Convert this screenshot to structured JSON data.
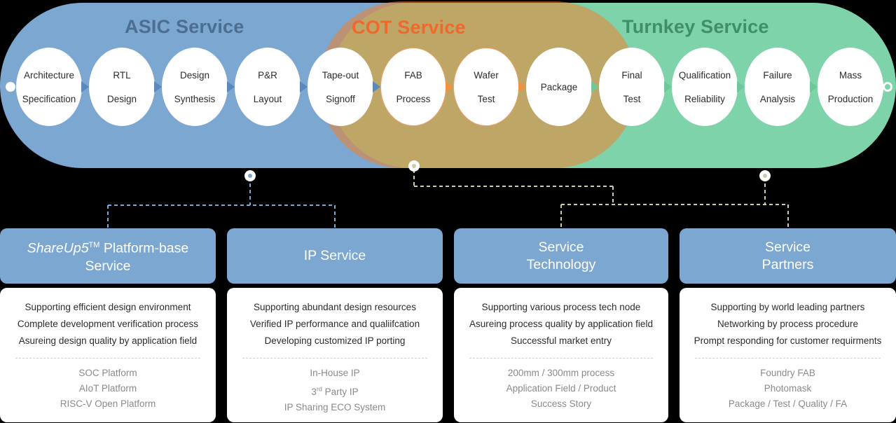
{
  "bands": [
    {
      "id": "asic",
      "title": "ASIC Service",
      "color": "#4b6e92"
    },
    {
      "id": "cot",
      "title": "COT Service",
      "color": "#f1682a"
    },
    {
      "id": "turnkey",
      "title": "Turnkey Service",
      "color": "#3f8f68"
    }
  ],
  "flow": {
    "nodes": [
      {
        "line1": "Architecture",
        "line2": "Specification"
      },
      {
        "line1": "RTL",
        "line2": "Design"
      },
      {
        "line1": "Design",
        "line2": "Synthesis"
      },
      {
        "line1": "P&R",
        "line2": "Layout"
      },
      {
        "line1": "Tape-out",
        "line2": "Signoff"
      },
      {
        "line1": "FAB",
        "line2": "Process"
      },
      {
        "line1": "Wafer",
        "line2": "Test"
      },
      {
        "line1": "Package",
        "line2": ""
      },
      {
        "line1": "Final",
        "line2": "Test"
      },
      {
        "line1": "Qualification",
        "line2": "Reliability"
      },
      {
        "line1": "Failure",
        "line2": "Analysis"
      },
      {
        "line1": "Mass",
        "line2": "Production"
      }
    ]
  },
  "cards": [
    {
      "title_pre": "ShareUp5",
      "title_tm": "TM",
      "title_post": " Platform-base Service",
      "primary": [
        "Supporting efficient design environment",
        "Complete development verification process",
        "Asureing design quality by application field"
      ],
      "secondary": [
        "SOC Platform",
        "AIoT Platform",
        "RISC-V Open Platform"
      ]
    },
    {
      "title_pre": "",
      "title_tm": "",
      "title_post": "IP Service",
      "primary": [
        "Supporting abundant design resources",
        "Verified IP performance and qualiifcation",
        "Developing customized IP porting"
      ],
      "secondary": [
        "In-House IP",
        "3rd Party IP",
        "IP Sharing ECO System"
      ]
    },
    {
      "title_pre": "",
      "title_tm": "",
      "title_post": "Service Technology",
      "primary": [
        "Supporting various process tech node",
        "Asureing process quality by application field",
        "Successful market entry"
      ],
      "secondary": [
        "200mm / 300mm process",
        "Application Field / Product",
        "Success Story"
      ]
    },
    {
      "title_pre": "",
      "title_tm": "",
      "title_post": "Service Partners",
      "primary": [
        "Supporting by world leading partners",
        "Networking by process procedure",
        "Prompt responding for customer requirments"
      ],
      "secondary": [
        "Foundry FAB",
        "Photomask",
        "Package / Test / Quality / FA"
      ]
    }
  ],
  "colors": {
    "asic_band": "#7ba7d1",
    "turnkey_band": "#7ed3aa",
    "cot_band": "#f3822d",
    "card_header": "#7ba7d1",
    "background": "#000000"
  }
}
